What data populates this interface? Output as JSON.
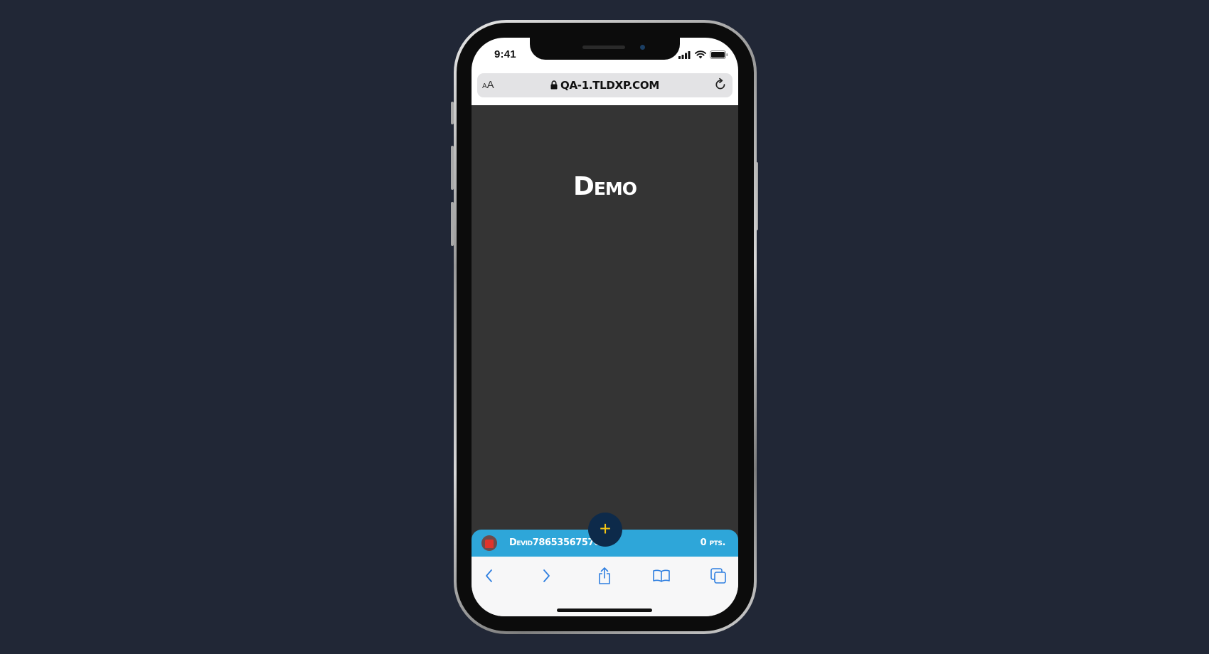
{
  "status_bar": {
    "time": "9:41"
  },
  "browser": {
    "text_size_label_small": "A",
    "text_size_label_large": "A",
    "url": "QA-1.TLDXP.COM"
  },
  "page": {
    "title": "Demo"
  },
  "player_bar": {
    "username": "Devid78653567570",
    "points": "0 pts."
  },
  "fab": {
    "label": "+"
  },
  "colors": {
    "background": "#212736",
    "content_bg": "#343434",
    "player_bar": "#2ea6d9",
    "fab_bg": "#0d2a4a",
    "fab_icon": "#f3c514",
    "toolbar_icon": "#2f7fe0"
  },
  "toolbar": {
    "icons": [
      "back-icon",
      "forward-icon",
      "share-icon",
      "bookmarks-icon",
      "tabs-icon"
    ]
  }
}
